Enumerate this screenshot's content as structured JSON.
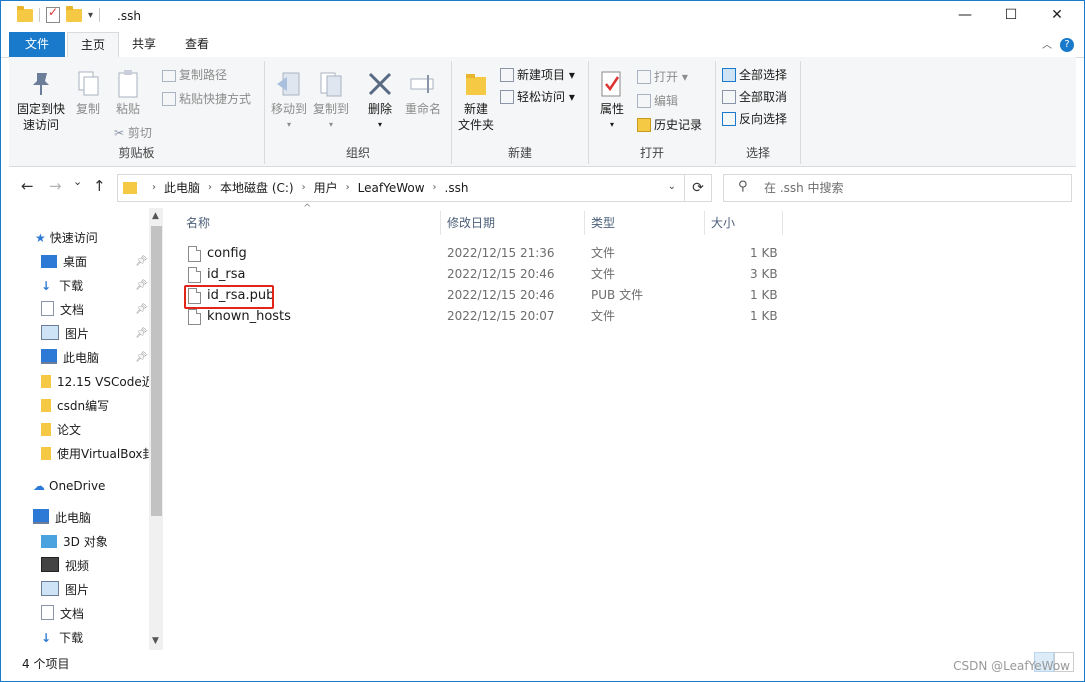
{
  "titlebar": {
    "title": ".ssh",
    "qat_dropdown": "▾",
    "minimize": "—",
    "maximize": "☐",
    "close": "✕"
  },
  "ribbon_tabs": {
    "file": "文件",
    "home": "主页",
    "share": "共享",
    "view": "查看",
    "collapse": "︿",
    "help": "?"
  },
  "ribbon": {
    "clipboard": {
      "pin_quick_access": "固定到快速访问",
      "pin_line1": "固定到快",
      "pin_line2": "速访问",
      "copy": "复制",
      "paste": "粘贴",
      "copy_path": "复制路径",
      "paste_shortcut": "粘贴快捷方式",
      "cut": "剪切",
      "label": "剪贴板"
    },
    "organize": {
      "move_to": "移动到",
      "copy_to": "复制到",
      "delete": "删除",
      "rename": "重命名",
      "label": "组织"
    },
    "new": {
      "new_folder_line1": "新建",
      "new_folder_line2": "文件夹",
      "new_item": "新建项目 ▾",
      "easy_access": "轻松访问 ▾",
      "label": "新建"
    },
    "open": {
      "properties": "属性",
      "open": "打开 ▾",
      "edit": "编辑",
      "history": "历史记录",
      "label": "打开"
    },
    "select": {
      "select_all": "全部选择",
      "select_none": "全部取消",
      "invert": "反向选择",
      "label": "选择"
    }
  },
  "navbar": {
    "back": "←",
    "forward": "→",
    "recent": "⌄",
    "up": "↑",
    "breadcrumb": [
      "此电脑",
      "本地磁盘 (C:)",
      "用户",
      "LeafYeWow",
      ".ssh"
    ],
    "refresh": "⟳",
    "search_placeholder": "在 .ssh 中搜索"
  },
  "navpane": {
    "quick_access": "快速访问",
    "items": [
      {
        "label": "桌面",
        "icon": "desktop-icon",
        "pinned": true
      },
      {
        "label": "下载",
        "icon": "download-icon",
        "pinned": true
      },
      {
        "label": "文档",
        "icon": "document-icon",
        "pinned": true
      },
      {
        "label": "图片",
        "icon": "picture-icon",
        "pinned": true
      },
      {
        "label": "此电脑",
        "icon": "computer-icon",
        "pinned": true
      },
      {
        "label": "12.15 VSCode近",
        "icon": "folder-icon",
        "pinned": false
      },
      {
        "label": "csdn编写",
        "icon": "folder-icon",
        "pinned": false
      },
      {
        "label": "论文",
        "icon": "folder-icon",
        "pinned": false
      },
      {
        "label": "使用VirtualBox封",
        "icon": "folder-icon",
        "pinned": false
      }
    ],
    "onedrive": "OneDrive",
    "this_pc": "此电脑",
    "pc_items": [
      {
        "label": "3D 对象",
        "icon": "3d-objects-icon"
      },
      {
        "label": "视频",
        "icon": "video-icon"
      },
      {
        "label": "图片",
        "icon": "picture-icon"
      },
      {
        "label": "文档",
        "icon": "document-icon"
      },
      {
        "label": "下载",
        "icon": "download-icon"
      }
    ]
  },
  "filelist": {
    "columns": {
      "name": "名称",
      "date": "修改日期",
      "type": "类型",
      "size": "大小"
    },
    "files": [
      {
        "name": "config",
        "date": "2022/12/15 21:36",
        "type": "文件",
        "size": "1 KB"
      },
      {
        "name": "id_rsa",
        "date": "2022/12/15 20:46",
        "type": "文件",
        "size": "3 KB"
      },
      {
        "name": "id_rsa.pub",
        "date": "2022/12/15 20:46",
        "type": "PUB 文件",
        "size": "1 KB"
      },
      {
        "name": "known_hosts",
        "date": "2022/12/15 20:07",
        "type": "文件",
        "size": "1 KB"
      }
    ],
    "highlighted_file": "id_rsa.pub"
  },
  "statusbar": {
    "count": "4 个项目",
    "watermark": "CSDN @LeafYeWow"
  },
  "colors": {
    "accent": "#1979ca",
    "highlight_border": "#e1251b",
    "folder": "#f6c945"
  }
}
